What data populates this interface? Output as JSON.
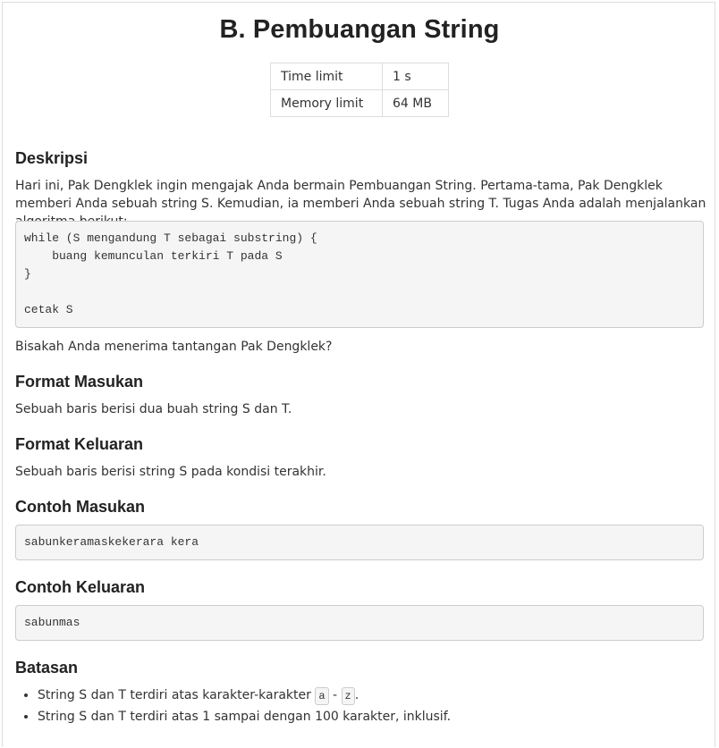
{
  "problem": {
    "title": "B. Pembuangan String",
    "limits": [
      {
        "label": "Time limit",
        "value": "1 s"
      },
      {
        "label": "Memory limit",
        "value": "64 MB"
      }
    ]
  },
  "sections": {
    "description": {
      "heading": "Deskripsi",
      "text": "Hari ini, Pak Dengklek ingin mengajak Anda bermain Pembuangan String. Pertama-tama, Pak Dengklek memberi Anda sebuah string S. Kemudian, ia memberi Anda sebuah string T. Tugas Anda adalah menjalankan algoritma berikut:",
      "code": "while (S mengandung T sebagai substring) {\n    buang kemunculan terkiri T pada S\n}\n\ncetak S",
      "closing": "Bisakah Anda menerima tantangan Pak Dengklek?"
    },
    "input_format": {
      "heading": "Format Masukan",
      "text": "Sebuah baris berisi dua buah string S dan T."
    },
    "output_format": {
      "heading": "Format Keluaran",
      "text": "Sebuah baris berisi string S pada kondisi terakhir."
    },
    "sample_input": {
      "heading": "Contoh Masukan",
      "code": "sabunkeramaskekerara kera"
    },
    "sample_output": {
      "heading": "Contoh Keluaran",
      "code": "sabunmas"
    },
    "constraints": {
      "heading": "Batasan",
      "item1_prefix": "String S dan T terdiri atas karakter-karakter",
      "item1_from": "a",
      "item1_sep": "-",
      "item1_to": "z",
      "item1_end": ".",
      "item2": "String S dan T terdiri atas 1 sampai dengan 100 karakter, inklusif."
    }
  }
}
